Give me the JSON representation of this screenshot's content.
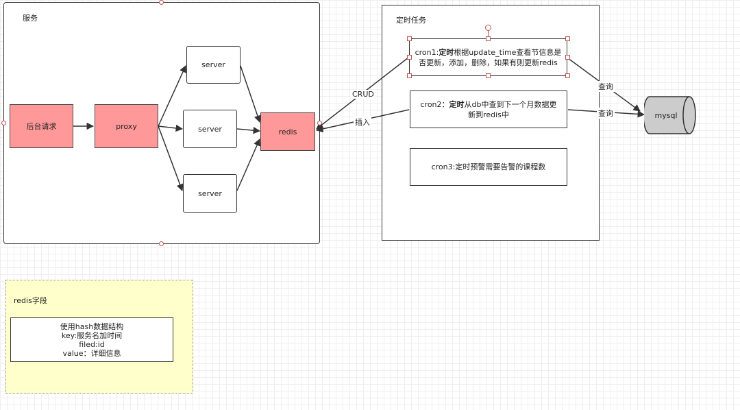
{
  "groups": {
    "service": {
      "title": "服务"
    },
    "cron": {
      "title": "定时任务"
    },
    "redis_fields": {
      "title": "redis字段"
    }
  },
  "nodes": {
    "backend_request": "后台请求",
    "proxy": "proxy",
    "server_1": "server",
    "server_2": "server",
    "server_3": "server",
    "redis": "redis",
    "mysql": "mysql",
    "cron1": {
      "prefix": "cron1:",
      "bold": "定时",
      "rest": "根据update_time查看节信息是否更新，添加，删除，如果有则更新redis"
    },
    "cron2": {
      "prefix": "cron2：",
      "bold": "定时",
      "rest": "从db中查到下一个月数据更新到redis中"
    },
    "cron3": "cron3:定时预警需要告警的课程数"
  },
  "redis_info": {
    "lines": [
      "使用hash数据结构",
      "key:服务名加时间",
      "filed:id",
      "value：详细信息"
    ]
  },
  "edge_labels": {
    "crud": "CRUD",
    "insert": "插入",
    "query_1": "查询",
    "query_2": "查询"
  },
  "colors": {
    "node_red": "#ff9999",
    "note_yellow": "#ffffcc",
    "cylinder_gray": "#cccccc",
    "selection_handle": "#b85450"
  }
}
